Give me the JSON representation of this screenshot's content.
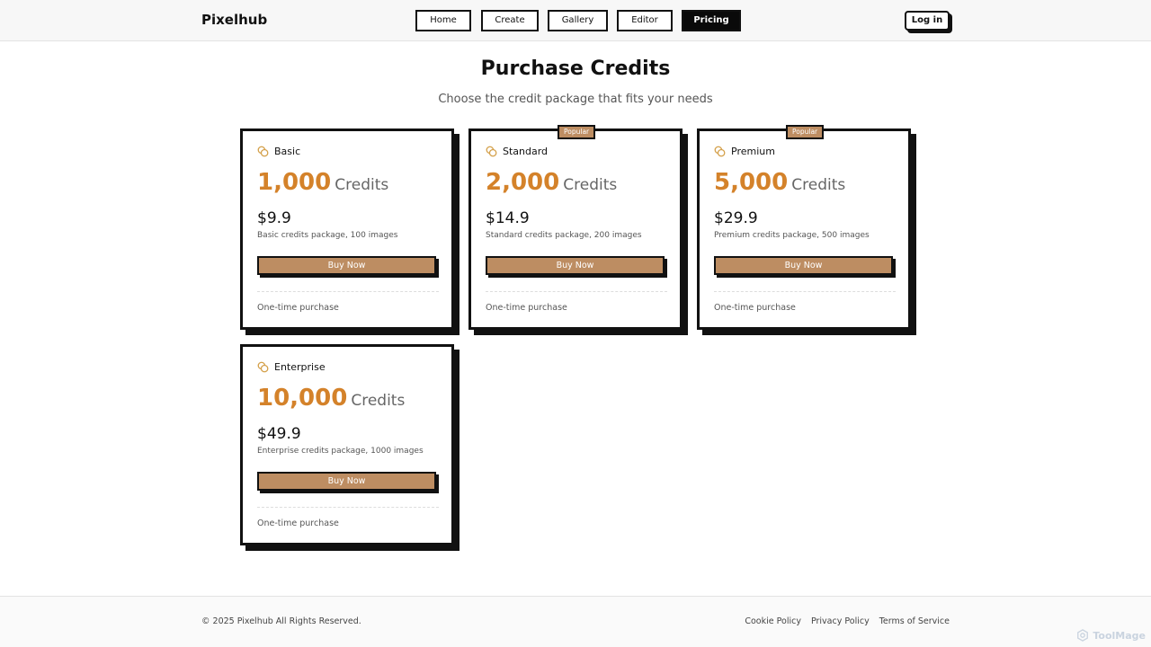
{
  "header": {
    "logo": "Pixelhub",
    "nav": [
      {
        "label": "Home"
      },
      {
        "label": "Create"
      },
      {
        "label": "Gallery"
      },
      {
        "label": "Editor"
      },
      {
        "label": "Pricing",
        "active": true
      }
    ],
    "login_label": "Log in"
  },
  "main": {
    "title": "Purchase Credits",
    "subtitle": "Choose the credit package that fits your needs",
    "credits_label": "Credits",
    "buy_label": "Buy Now",
    "note": "One-time purchase",
    "packages": [
      {
        "name": "Basic",
        "credits": "1,000",
        "price": "$9.9",
        "description": "Basic credits package, 100 images",
        "badge": ""
      },
      {
        "name": "Standard",
        "credits": "2,000",
        "price": "$14.9",
        "description": "Standard credits package, 200 images",
        "badge": "Popular"
      },
      {
        "name": "Premium",
        "credits": "5,000",
        "price": "$29.9",
        "description": "Premium credits package, 500 images",
        "badge": "Popular"
      },
      {
        "name": "Enterprise",
        "credits": "10,000",
        "price": "$49.9",
        "description": "Enterprise credits package, 1000 images",
        "badge": ""
      }
    ]
  },
  "footer": {
    "copyright": "© 2025 Pixelhub All Rights Reserved.",
    "links": [
      "Cookie Policy",
      "Privacy Policy",
      "Terms of Service"
    ]
  },
  "watermark": "ToolMage",
  "colors": {
    "accent": "#d4822a",
    "button": "#bd8d62",
    "border": "#111111"
  },
  "icons": {
    "package": "coins-icon",
    "watermark": "toolmage-logo-icon"
  }
}
